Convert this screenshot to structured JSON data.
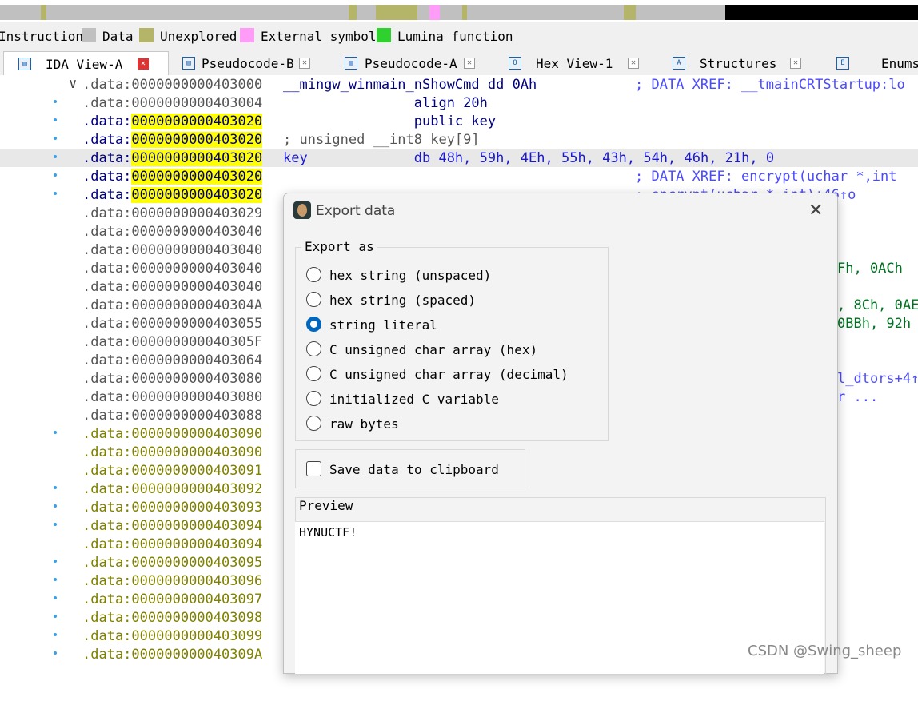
{
  "legend": {
    "items": [
      {
        "label": "Instruction",
        "color": "#87cefa"
      },
      {
        "label": "Data",
        "color": "#c0c0c0"
      },
      {
        "label": "Unexplored",
        "color": "#b5b56a"
      },
      {
        "label": "External symbol",
        "color": "#ff9cf7"
      },
      {
        "label": "Lumina function",
        "color": "#2fd12f"
      }
    ]
  },
  "tabs": [
    {
      "label": "IDA View-A",
      "icon": "IDA",
      "active": true
    },
    {
      "label": "Pseudocode-B",
      "icon": "P"
    },
    {
      "label": "Pseudocode-A",
      "icon": "P"
    },
    {
      "label": "Hex View-1",
      "icon": "O"
    },
    {
      "label": "Structures",
      "icon": "A"
    },
    {
      "label": "Enums",
      "icon": "E"
    }
  ],
  "code_rows": [
    {
      "seg": ".data:",
      "addr": "0000000000403000",
      "text": "__mingw_winmain_nShowCmd dd 0Ah",
      "comment": "; DATA XREF: __tmainCRTStartup:lo"
    },
    {
      "seg": ".data:",
      "addr": "0000000000403004",
      "text": "                align 20h",
      "comment": ""
    },
    {
      "seg": ".data:",
      "addr": "0000000000403020",
      "text": "                public key",
      "comment": ""
    },
    {
      "seg": ".data:",
      "addr": "0000000000403020",
      "text": "; unsigned __int8 key[9]",
      "comment": ""
    },
    {
      "seg": ".data:",
      "addr": "0000000000403020",
      "text": "key             db 48h, 59h, 4Eh, 55h, 43h, 54h, 46h, 21h, 0",
      "comment": ""
    },
    {
      "seg": ".data:",
      "addr": "0000000000403020",
      "text": "",
      "comment": "; DATA XREF: encrypt(uchar *,int"
    },
    {
      "seg": ".data:",
      "addr": "0000000000403020",
      "text": "",
      "comment": "; encrypt(uchar *,int)+46↑o"
    },
    {
      "seg": ".data:",
      "addr": "0000000000403029",
      "text": "",
      "comment": ""
    },
    {
      "seg": ".data:",
      "addr": "0000000000403040",
      "text": "",
      "comment": ""
    },
    {
      "seg": ".data:",
      "addr": "0000000000403040",
      "text": "",
      "comment": ""
    },
    {
      "seg": ".data:",
      "addr": "0000000000403040",
      "text": "",
      "right": "Fh, 0ACh"
    },
    {
      "seg": ".data:",
      "addr": "0000000000403040",
      "text": "",
      "comment": ""
    },
    {
      "seg": ".data:",
      "addr": "000000000040304A",
      "text": "",
      "right": ", 8Ch, 0AE"
    },
    {
      "seg": ".data:",
      "addr": "0000000000403055",
      "text": "",
      "right": "0BBh, 92h"
    },
    {
      "seg": ".data:",
      "addr": "000000000040305F",
      "text": "",
      "comment": ""
    },
    {
      "seg": ".data:",
      "addr": "0000000000403064",
      "text": "",
      "comment": ""
    },
    {
      "seg": ".data:",
      "addr": "0000000000403080",
      "text": "",
      "rightcmt": "l_dtors+4↑"
    },
    {
      "seg": ".data:",
      "addr": "0000000000403080",
      "text": "",
      "rightcmt": "r ..."
    },
    {
      "seg": ".data:",
      "addr": "0000000000403088",
      "text": "",
      "comment": ""
    },
    {
      "seg": ".data:",
      "addr": "0000000000403090",
      "text": "",
      "comment": ""
    },
    {
      "seg": ".data:",
      "addr": "0000000000403090",
      "text": "",
      "comment": ""
    },
    {
      "seg": ".data:",
      "addr": "0000000000403091",
      "text": "",
      "comment": ""
    },
    {
      "seg": ".data:",
      "addr": "0000000000403092",
      "text": "",
      "comment": ""
    },
    {
      "seg": ".data:",
      "addr": "0000000000403093",
      "text": "",
      "comment": ""
    },
    {
      "seg": ".data:",
      "addr": "0000000000403094",
      "text": "",
      "comment": ""
    },
    {
      "seg": ".data:",
      "addr": "0000000000403094",
      "text": "",
      "comment": ""
    },
    {
      "seg": ".data:",
      "addr": "0000000000403095",
      "text": "",
      "comment": ""
    },
    {
      "seg": ".data:",
      "addr": "0000000000403096",
      "text": "",
      "comment": ""
    },
    {
      "seg": ".data:",
      "addr": "0000000000403097",
      "text": "",
      "comment": ""
    },
    {
      "seg": ".data:",
      "addr": "0000000000403098",
      "text": "",
      "comment": ""
    },
    {
      "seg": ".data:",
      "addr": "0000000000403099",
      "text": "",
      "comment": ""
    },
    {
      "seg": ".data:",
      "addr": "000000000040309A",
      "text": "",
      "comment": ""
    }
  ],
  "dialog": {
    "title": "Export data",
    "export_as_label": "Export as",
    "options": [
      {
        "label": "hex string (unspaced)",
        "selected": false
      },
      {
        "label": "hex string (spaced)",
        "selected": false
      },
      {
        "label": "string literal",
        "selected": true
      },
      {
        "label": "C unsigned char array (hex)",
        "selected": false
      },
      {
        "label": "C unsigned char array (decimal)",
        "selected": false
      },
      {
        "label": "initialized C variable",
        "selected": false
      },
      {
        "label": "raw bytes",
        "selected": false
      }
    ],
    "save_clipboard_label": "Save data to clipboard",
    "save_clipboard_checked": false,
    "preview_label": "Preview",
    "preview_text": "HYNUCTF!"
  },
  "watermark": "CSDN @Swing_sheep"
}
